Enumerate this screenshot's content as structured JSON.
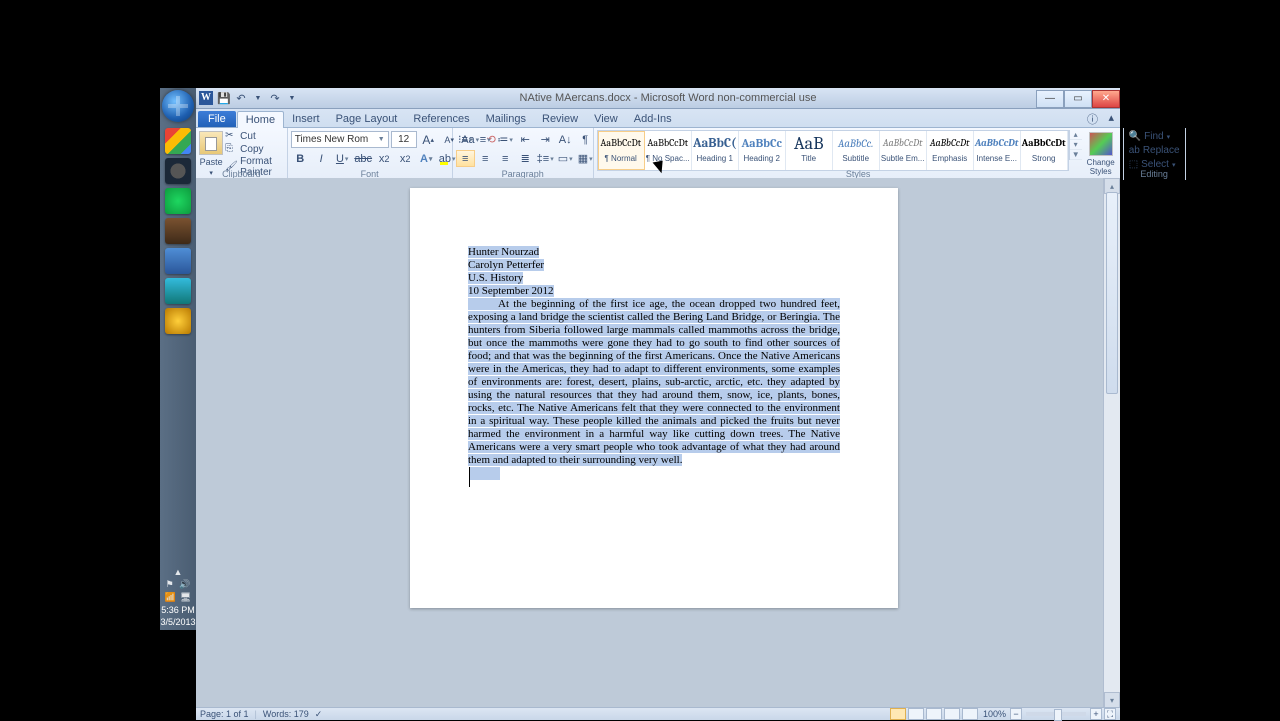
{
  "taskbar": {
    "icons": [
      {
        "name": "chrome-icon",
        "bg": "linear-gradient(135deg,#ea4335 30%,#fbbc05 30% 55%,#34a853 55% 80%,#4285f4 80%)"
      },
      {
        "name": "steam-icon",
        "bg": "radial-gradient(circle at 50% 50%,#555 40%,#1b2838 42%)"
      },
      {
        "name": "spotify-icon",
        "bg": "radial-gradient(circle,#1ed760,#0d9b3e)"
      },
      {
        "name": "minecraft-icon",
        "bg": "linear-gradient(#7a5230,#3e2a18)"
      },
      {
        "name": "word-icon",
        "bg": "linear-gradient(#4f8ed6,#2b579a)"
      },
      {
        "name": "teamspeak-icon",
        "bg": "linear-gradient(#3bd,#177)"
      },
      {
        "name": "media-icon",
        "bg": "radial-gradient(circle,#ffcf3a,#b87800)"
      }
    ],
    "time": "5:36 PM",
    "date": "3/5/2013"
  },
  "window": {
    "qat": [
      "save-icon",
      "◂",
      "undo-icon",
      "▾",
      "redo-icon",
      "▾"
    ],
    "title": "NAtive MAercans.docx - Microsoft Word non-commercial use",
    "tabs": [
      "Home",
      "Insert",
      "Page Layout",
      "References",
      "Mailings",
      "Review",
      "View",
      "Add-Ins"
    ],
    "file": "File"
  },
  "ribbon": {
    "clipboard": {
      "label": "Clipboard",
      "paste": "Paste",
      "cut": "Cut",
      "copy": "Copy",
      "fp": "Format Painter"
    },
    "font": {
      "label": "Font",
      "name": "Times New Rom",
      "size": "12"
    },
    "paragraph": {
      "label": "Paragraph"
    },
    "styles": {
      "label": "Styles",
      "items": [
        {
          "samp": "AaBbCcDt",
          "name": "¶ Normal",
          "sel": true,
          "size": "10px",
          "color": "#000"
        },
        {
          "samp": "AaBbCcDt",
          "name": "¶ No Spac...",
          "size": "10px",
          "color": "#000"
        },
        {
          "samp": "AaBbC(",
          "name": "Heading 1",
          "size": "13px",
          "color": "#365f91",
          "weight": "bold"
        },
        {
          "samp": "AaBbCc",
          "name": "Heading 2",
          "size": "12px",
          "color": "#4f81bd",
          "weight": "bold"
        },
        {
          "samp": "AaB",
          "name": "Title",
          "size": "18px",
          "color": "#17365d"
        },
        {
          "samp": "AaBbCc.",
          "name": "Subtitle",
          "size": "11px",
          "color": "#4f81bd",
          "style": "italic"
        },
        {
          "samp": "AaBbCcDt",
          "name": "Subtle Em...",
          "size": "10px",
          "color": "#808080",
          "style": "italic"
        },
        {
          "samp": "AaBbCcDt",
          "name": "Emphasis",
          "size": "10px",
          "color": "#000",
          "style": "italic"
        },
        {
          "samp": "AaBbCcDt",
          "name": "Intense E...",
          "size": "10px",
          "color": "#4f81bd",
          "style": "italic",
          "weight": "bold"
        },
        {
          "samp": "AaBbCcDt",
          "name": "Strong",
          "size": "10px",
          "color": "#000",
          "weight": "bold"
        }
      ],
      "change": "Change Styles"
    },
    "editing": {
      "label": "Editing",
      "find": "Find",
      "replace": "Replace",
      "select": "Select"
    }
  },
  "document": {
    "lines": [
      "Hunter Nourzad",
      "Carolyn Petterfer",
      "U.S. History",
      "10 September 2012"
    ],
    "body": "At the beginning of the first ice age, the ocean dropped two hundred feet, exposing a land bridge the scientist called the Bering Land Bridge, or Beringia. The hunters from Siberia followed large mammals called mammoths across the bridge, but once the mammoths were gone they had to go south to find other sources of food; and that was the beginning of the first Americans. Once the Native Americans were in the Americas, they had to adapt to different environments, some examples of environments are: forest, desert, plains, sub-arctic, arctic, etc. they adapted by using the natural resources that they had around them, snow, ice, plants, bones, rocks, etc. The Native Americans felt that they were connected to the environment in a spiritual way. These people killed the animals and picked the fruits but never harmed the environment in a harmful way like cutting down trees. The Native Americans were a very smart people who took advantage of what they had around them and adapted to their surrounding very well."
  },
  "status": {
    "page": "Page: 1 of 1",
    "words": "Words: 179",
    "zoom": "100%"
  }
}
